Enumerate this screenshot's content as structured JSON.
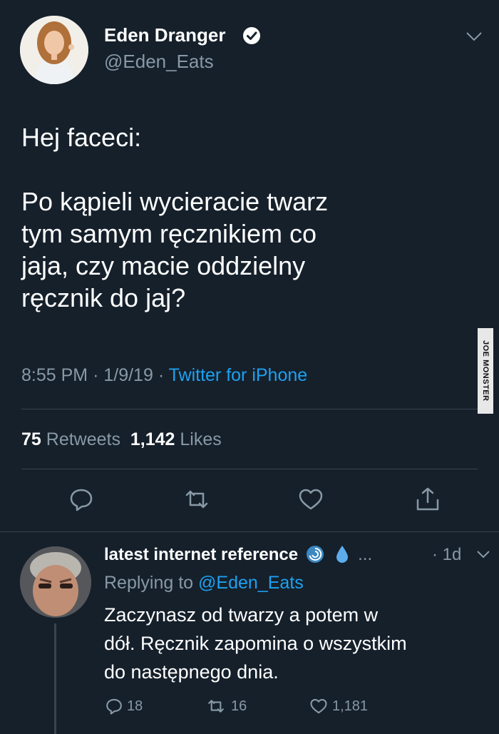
{
  "tweet": {
    "author_name": "Eden Dranger",
    "author_handle": "@Eden_Eats",
    "text": "Hej faceci:\n\nPo kąpieli wycieracie twarz\ntym samym ręcznikiem co\njaja, czy macie oddzielny\nręcznik do jaj?",
    "time": "8:55 PM",
    "date": "1/9/19",
    "separator": "·",
    "source": "Twitter for iPhone",
    "retweets_count": "75",
    "retweets_label": "Retweets",
    "likes_count": "1,142",
    "likes_label": "Likes"
  },
  "watermark": "JOE MONSTER",
  "reply": {
    "author_name": "latest internet reference",
    "name_suffix": "...",
    "time": "· 1d",
    "replying_label": "Replying to",
    "replying_handle": "@Eden_Eats",
    "text": "Zaczynasz od twarzy a potem w\ndół. Ręcznik zapomina o wszystkim\ndo następnego dnia.",
    "reply_count": "18",
    "retweet_count": "16",
    "like_count": "1,181"
  },
  "colors": {
    "background": "#15202b",
    "muted": "#8899a6",
    "accent": "#1da1f2",
    "divider": "#38444d"
  },
  "icons": [
    "verified-badge-icon",
    "chevron-down-icon",
    "reply-icon",
    "retweet-icon",
    "like-icon",
    "share-icon",
    "cyclone-emoji-icon",
    "droplet-emoji-icon"
  ]
}
